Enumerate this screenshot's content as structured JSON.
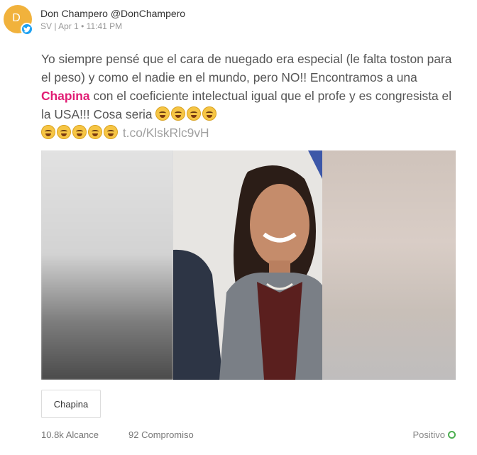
{
  "author": {
    "name_handle": "Don Champero @DonChampero",
    "avatar_letter": "D",
    "meta": "SV |  Apr 1 • 11:41 PM"
  },
  "post": {
    "text_part1": "Yo siempre pensé que el cara de nuegado era especial (le falta toston para el peso) y como el nadie en el mundo, pero NO!! Encontramos a una ",
    "highlight": "Chapina",
    "text_part2": " con el coeficiente intelectual igual que el profe y es congresista el la USA!!! Cosa seria ",
    "link": "t.co/KlskRlc9vH"
  },
  "tag": {
    "label": "Chapina"
  },
  "stats": {
    "reach": "10.8k Alcance",
    "engagement": "92 Compromiso",
    "sentiment": "Positivo"
  },
  "colors": {
    "avatar": "#f1b23c",
    "highlight": "#e11d74",
    "twitter": "#1da1f2",
    "positive": "#4caf50"
  },
  "icons": [
    "twitter-icon",
    "laughing-emoji-icon",
    "positive-circle-icon"
  ]
}
